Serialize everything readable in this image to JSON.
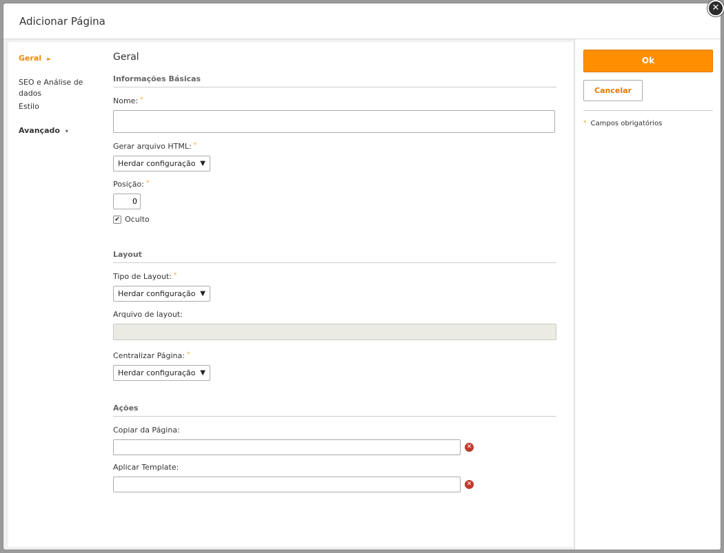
{
  "dialog": {
    "title": "Adicionar Página",
    "close_glyph": "✕"
  },
  "nav": {
    "items": [
      {
        "label": "Geral"
      },
      {
        "label": "SEO e Análise de dados"
      },
      {
        "label": "Estilo"
      },
      {
        "label": "Avançado"
      }
    ],
    "active_arrow": "►",
    "caret": "▾"
  },
  "main": {
    "section_title": "Geral",
    "basic_group": "Informações Básicas",
    "nome_label": "Nome:",
    "nome_value": "",
    "html_label": "Gerar arquivo HTML:",
    "html_value": "Herdar configuração",
    "posicao_label": "Posição:",
    "posicao_value": "0",
    "oculto_label": "Oculto",
    "oculto_checked": true,
    "layout_group": "Layout",
    "tipo_layout_label": "Tipo de Layout:",
    "tipo_layout_value": "Herdar configuração",
    "arquivo_layout_label": "Arquivo de layout:",
    "centralizar_label": "Centralizar Página:",
    "centralizar_value": "Herdar configuração",
    "acoes_group": "Ações",
    "copiar_label": "Copiar da Página:",
    "template_label": "Aplicar Template:",
    "required_mark": "*",
    "select_arrow": "▼",
    "check_mark": "✔",
    "clear_glyph": "✕"
  },
  "side": {
    "ok_label": "Ok",
    "cancel_label": "Cancelar",
    "required_note": "Campos obrigatórios"
  },
  "colors": {
    "accent": "#ff8f00",
    "required": "#f5a623",
    "clear": "#c0392b"
  }
}
